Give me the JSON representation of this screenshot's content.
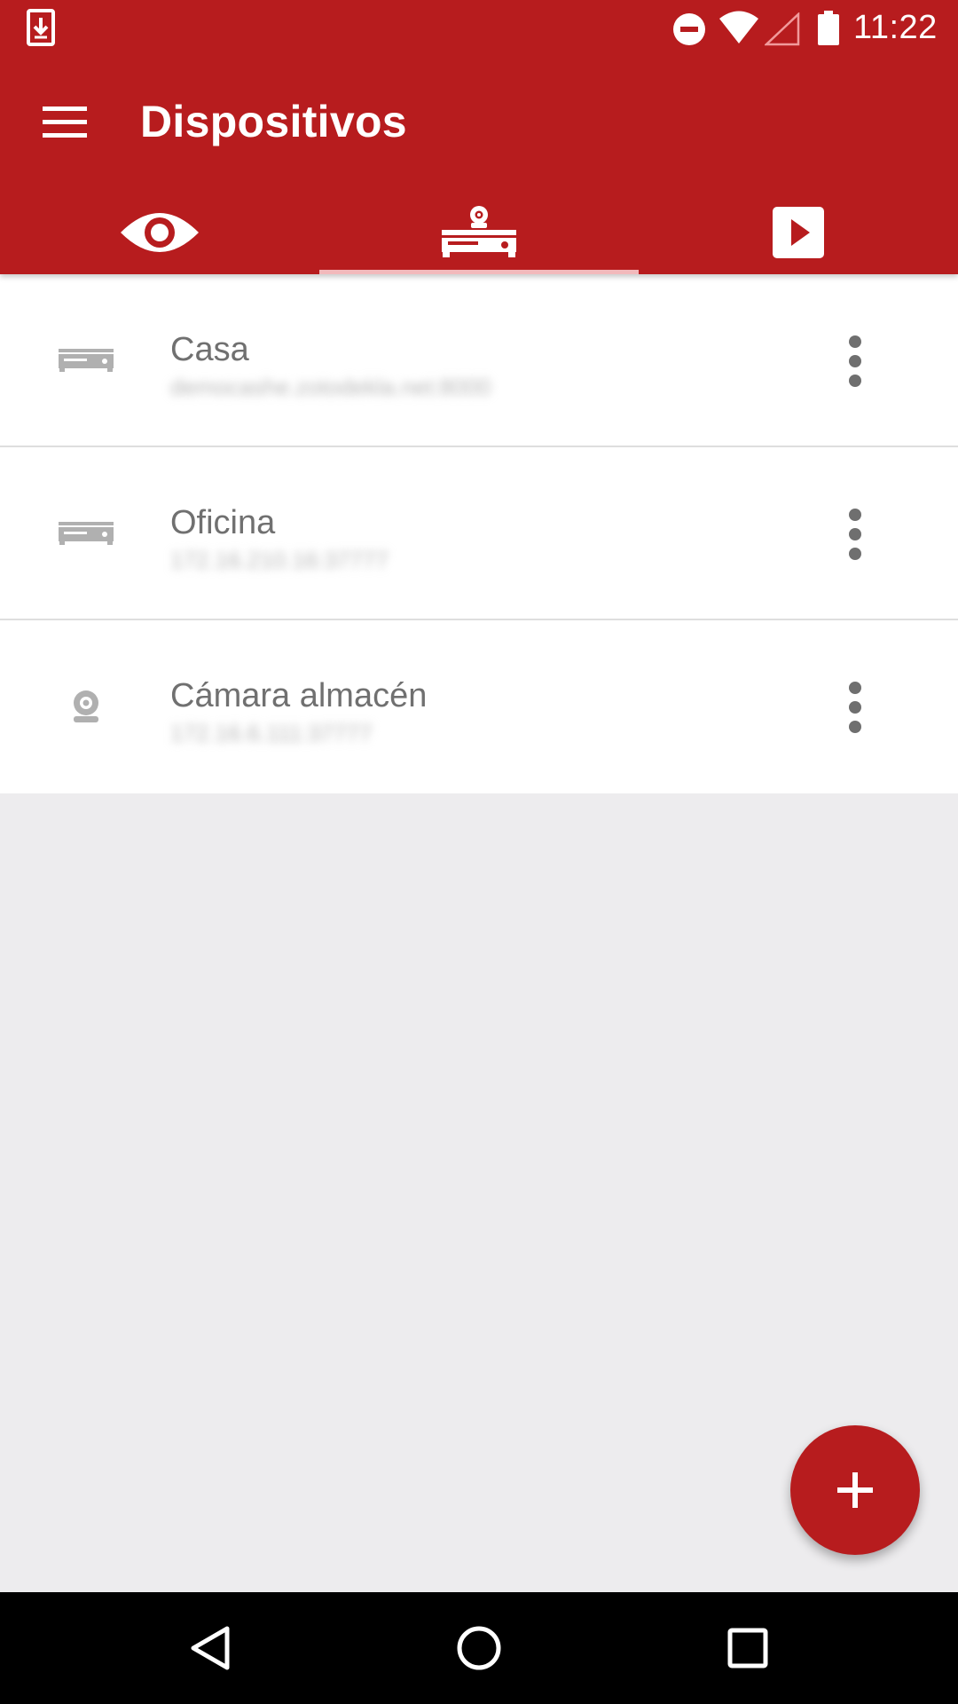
{
  "status_bar": {
    "time": "11:22",
    "icons": [
      "download-icon",
      "dnd-icon",
      "wifi-icon",
      "signal-icon",
      "battery-icon"
    ]
  },
  "toolbar": {
    "title": "Dispositivos",
    "menu_icon": "menu-icon"
  },
  "tabs": [
    {
      "icon": "eye-icon",
      "active": false
    },
    {
      "icon": "dvr-camera-icon",
      "active": true
    },
    {
      "icon": "play-icon",
      "active": false
    }
  ],
  "devices": [
    {
      "name": "Casa",
      "address": "democashe.zotodekla.net:8000",
      "icon": "dvr-icon"
    },
    {
      "name": "Oficina",
      "address": "172.16.210.16:37777",
      "icon": "dvr-icon"
    },
    {
      "name": "Cámara almacén",
      "address": "172.16.6.111:37777",
      "icon": "webcam-icon"
    }
  ],
  "fab": {
    "icon": "plus-icon"
  },
  "nav_bar": {
    "icons": [
      "back-icon",
      "home-icon",
      "recents-icon"
    ]
  },
  "colors": {
    "primary": "#b71c1e",
    "tab_indicator": "#f2b9bb",
    "background": "#edecee",
    "title_text": "#707070"
  }
}
